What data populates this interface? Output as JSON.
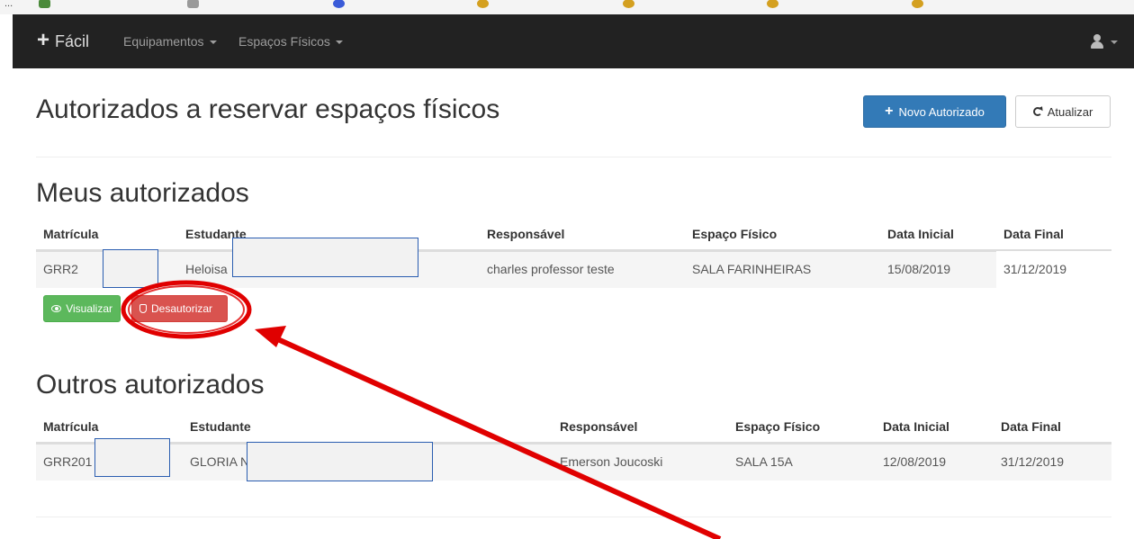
{
  "navbar": {
    "brand": "Fácil",
    "menu": [
      {
        "label": "Equipamentos"
      },
      {
        "label": "Espaços Físicos"
      }
    ]
  },
  "page": {
    "title": "Autorizados a reservar espaços físicos",
    "new_button": "Novo Autorizado",
    "refresh_button": "Atualizar"
  },
  "meus": {
    "title": "Meus autorizados",
    "columns": [
      "Matrícula",
      "Estudante",
      "Responsável",
      "Espaço Físico",
      "Data Inicial",
      "Data Final"
    ],
    "rows": [
      {
        "matricula": "GRR2",
        "estudante": "Heloisa",
        "responsavel": "charles professor teste",
        "espaco": "SALA FARINHEIRAS",
        "inicio": "15/08/2019",
        "fim": "31/12/2019"
      }
    ],
    "view_button": "Visualizar",
    "revoke_button": "Desautorizar"
  },
  "outros": {
    "title": "Outros autorizados",
    "columns": [
      "Matrícula",
      "Estudante",
      "Responsável",
      "Espaço Físico",
      "Data Inicial",
      "Data Final"
    ],
    "rows": [
      {
        "matricula": "GRR201",
        "estudante": "GLORIA N",
        "responsavel": "Emerson Joucoski",
        "espaco": "SALA 15A",
        "inicio": "12/08/2019",
        "fim": "31/12/2019"
      }
    ]
  },
  "colors": {
    "navbar": "#222222",
    "primary": "#337ab7",
    "success": "#5cb85c",
    "danger": "#d9534f",
    "annotation": "#e00000"
  }
}
